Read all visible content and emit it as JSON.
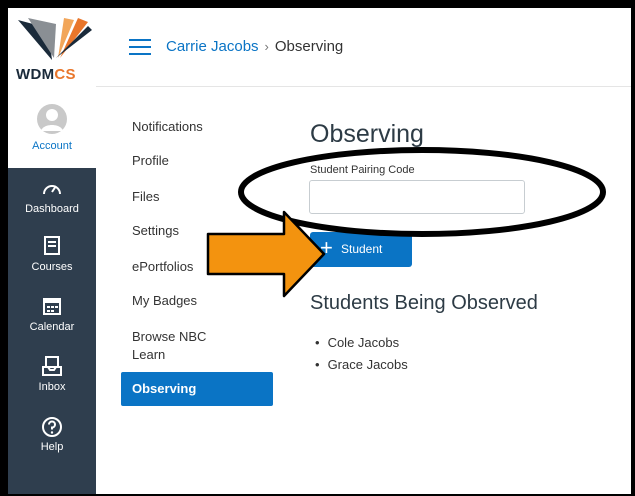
{
  "logo": {
    "text_main": "WDM",
    "text_accent": "CS"
  },
  "global_nav": {
    "account_label": "Account",
    "items": [
      {
        "label": "Dashboard",
        "icon": "dashboard-icon"
      },
      {
        "label": "Courses",
        "icon": "courses-icon"
      },
      {
        "label": "Calendar",
        "icon": "calendar-icon"
      },
      {
        "label": "Inbox",
        "icon": "inbox-icon"
      },
      {
        "label": "Help",
        "icon": "help-icon"
      }
    ]
  },
  "header": {
    "breadcrumb_user": "Carrie Jacobs",
    "breadcrumb_separator": "›",
    "breadcrumb_page": "Observing"
  },
  "secondary_nav": {
    "items": [
      "Notifications",
      "Profile",
      "Files",
      "Settings",
      "ePortfolios",
      "My Badges",
      "Browse NBC",
      "Learn"
    ],
    "active": "Observing"
  },
  "main": {
    "title": "Observing",
    "pairing_code_label": "Student Pairing Code",
    "pairing_code_value": "",
    "add_button_plus": "+",
    "add_button_label": "Student",
    "observed_title": "Students Being Observed",
    "students": [
      "Cole Jacobs",
      "Grace Jacobs"
    ]
  },
  "colors": {
    "accent": "#0a74c5",
    "nav_bg": "#2f3e4e",
    "annotation_arrow": "#f3930f",
    "annotation_ellipse": "#000000"
  }
}
